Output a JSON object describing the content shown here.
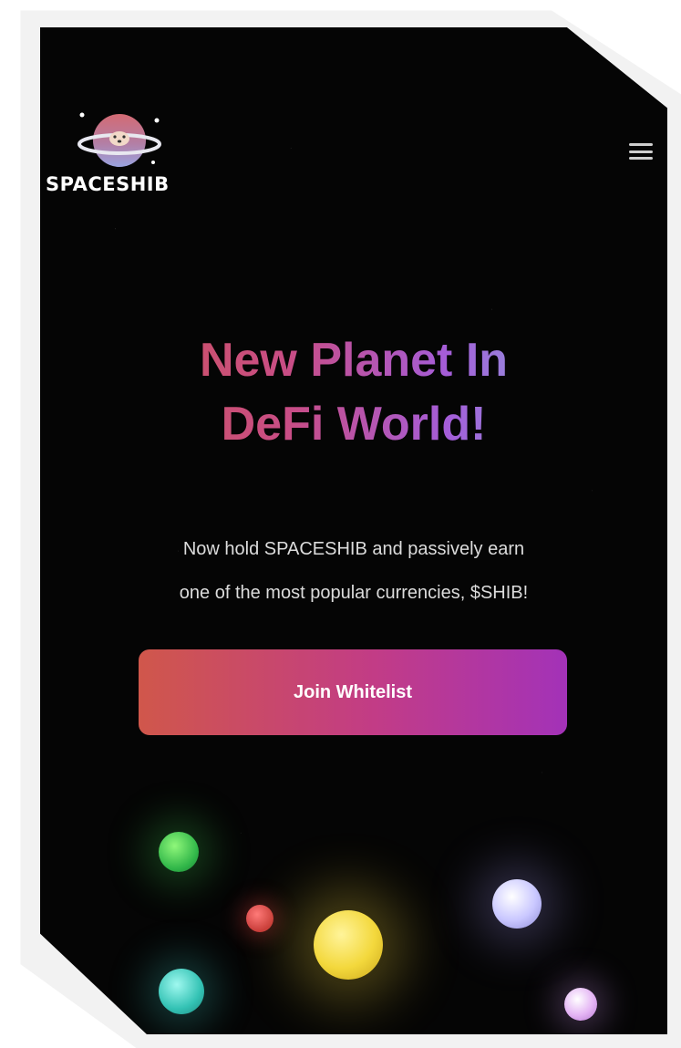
{
  "header": {
    "brand_name": "SPACESHIB",
    "logo_icon": "planet-shiba-logo-icon",
    "menu_icon": "hamburger-menu-icon"
  },
  "hero": {
    "title_line_1": "New Planet In",
    "title_line_2": "DeFi World!",
    "subtitle_line_1": "Now hold SPACESHIB and passively earn",
    "subtitle_line_2": "one of the most popular currencies, $SHIB!",
    "cta_label": "Join Whitelist"
  },
  "colors": {
    "background": "#050505",
    "gradient_start": "#d0574b",
    "gradient_mid": "#c84d86",
    "gradient_purple": "#a45dd8",
    "gradient_end": "#7dd6e4",
    "subtitle_text": "#dcdcdc"
  }
}
